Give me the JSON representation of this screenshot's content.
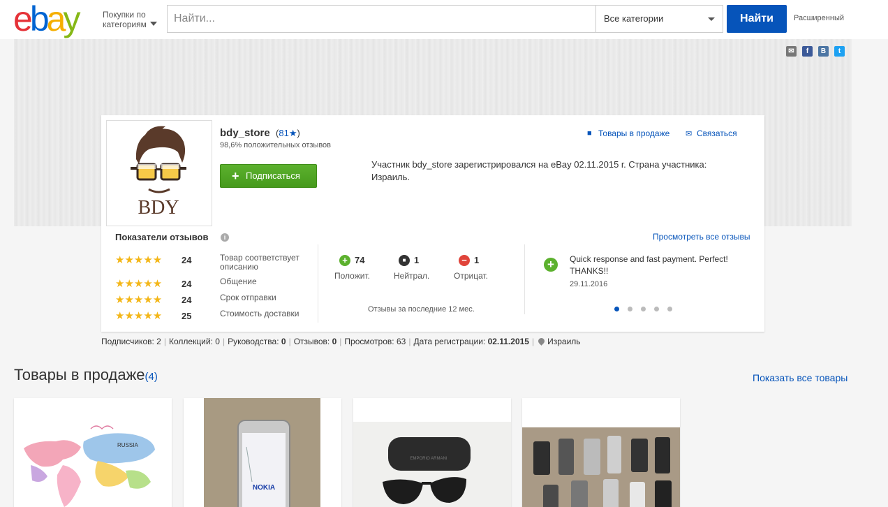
{
  "header": {
    "logo": [
      "e",
      "b",
      "a",
      "y"
    ],
    "logo_colors": [
      "#e53238",
      "#0064d2",
      "#f5af02",
      "#86b817"
    ],
    "shop_by_label": "Покупки по категориям",
    "search_placeholder": "Найти...",
    "category_select": "Все категории",
    "search_button": "Найти",
    "advanced_link": "Расширенный"
  },
  "share_icons": [
    "email-icon",
    "facebook-icon",
    "vk-icon",
    "twitter-icon"
  ],
  "profile": {
    "store_name": "bdy_store",
    "score_open": "(",
    "score": "81",
    "score_star": "★",
    "score_close": ")",
    "positive_feedback": "98,6% положительных отзывов",
    "follow_button": "Подписаться",
    "items_for_sale_link": "Товары в продаже",
    "contact_link": "Связаться",
    "about": "Участник bdy_store зарегистрировался на eBay 02.11.2015 г. Страна участника: Израиль.",
    "avatar_text": "BDY"
  },
  "feedback": {
    "title": "Показатели отзывов",
    "view_all_link": "Просмотреть все отзывы",
    "ratings": [
      {
        "stars": "★★★★★",
        "count": "24",
        "label": "Товар соответствует описанию"
      },
      {
        "stars": "★★★★★",
        "count": "24",
        "label": "Общение"
      },
      {
        "stars": "★★★★★",
        "count": "24",
        "label": "Срок отправки"
      },
      {
        "stars": "★★★★★",
        "count": "25",
        "label": "Стоимость доставки"
      }
    ],
    "counts": [
      {
        "value": "74",
        "label": "Положит.",
        "color": "#5cb12e",
        "icon": "+"
      },
      {
        "value": "1",
        "label": "Нейтрал.",
        "color": "#333333",
        "icon": "■"
      },
      {
        "value": "1",
        "label": "Отрицат.",
        "color": "#e0443a",
        "icon": "−"
      }
    ],
    "period": "Отзывы за последние 12 мес.",
    "comment": {
      "text": "Quick response and fast payment. Perfect! THANKS!!",
      "date": "29.11.2016"
    }
  },
  "stats": {
    "followers_label": "Подписчиков: ",
    "followers": "2",
    "collections_label": "Коллекций: ",
    "collections": "0",
    "guides_label": "Руководства: ",
    "guides": "0",
    "reviews_label": "Отзывов: ",
    "reviews": "0",
    "views_label": "Просмотров: ",
    "views": "63",
    "registered_label": "Дата регистрации: ",
    "registered": "02.11.2015",
    "country": "Израиль"
  },
  "listings": {
    "title": "Товары в продаже",
    "count": "(4)",
    "show_all": "Показать все товары",
    "items": [
      {
        "map_label": "RUSSIA"
      },
      {
        "phone_brand": "NOKIA"
      },
      {
        "case_brand": "EMPORIO ARMANI"
      },
      {}
    ]
  },
  "colors": {
    "accent": "#0654ba",
    "follow_green": "#5cb12e",
    "star_gold": "#f3b617"
  }
}
